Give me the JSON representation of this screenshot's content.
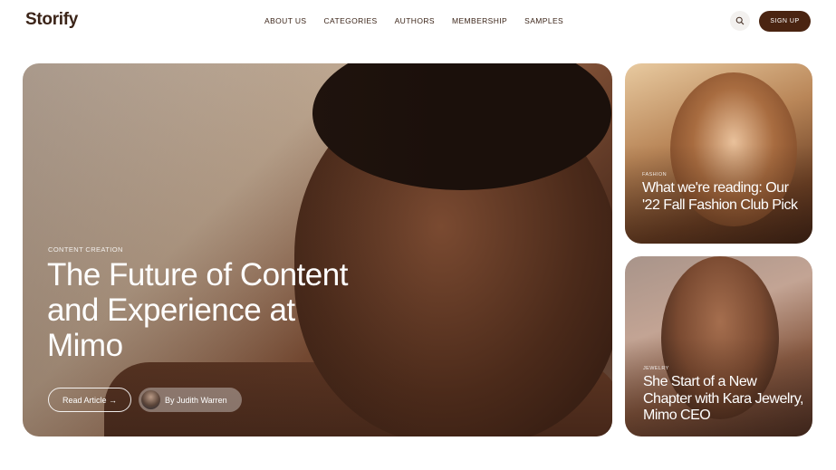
{
  "brand": {
    "logo": "Storify"
  },
  "nav": {
    "items": [
      "ABOUT US",
      "CATEGORIES",
      "AUTHORS",
      "MEMBERSHIP",
      "SAMPLES"
    ]
  },
  "header": {
    "signup_label": "SIGN UP",
    "search_icon": "search-icon"
  },
  "hero": {
    "category": "CONTENT CREATION",
    "title": "The Future of Content and Experience at Mimo",
    "read_label": "Read Article →",
    "author_label": "By Judith Warren"
  },
  "side_articles": [
    {
      "category": "FASHION",
      "title": "What we're reading: Our '22 Fall Fashion Club Pick"
    },
    {
      "category": "JEWELRY",
      "title": "She Start of a New Chapter with Kara Jewelry, Mimo CEO"
    }
  ],
  "colors": {
    "accent": "#4a2411",
    "text": "#3b2418",
    "background": "#ffffff"
  }
}
